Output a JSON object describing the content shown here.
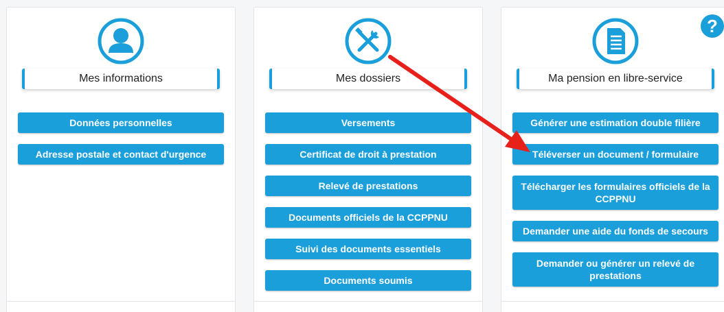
{
  "panels": {
    "info": {
      "title": "Mes informations",
      "icon": "user-icon",
      "buttons": [
        "Données personnelles",
        "Adresse postale et contact d'urgence"
      ]
    },
    "dossiers": {
      "title": "Mes dossiers",
      "icon": "tools-icon",
      "buttons": [
        "Versements",
        "Certificat de droit à prestation",
        "Relevé de prestations",
        "Documents officiels de la CCPPNU",
        "Suivi des documents essentiels",
        "Documents soumis"
      ]
    },
    "pension": {
      "title": "Ma pension en libre-service",
      "icon": "document-icon",
      "buttons": [
        "Générer une estimation double filière",
        "Téléverser un document / formulaire",
        "Télécharger les formulaires officiels de la CCPPNU",
        "Demander une aide du fonds de secours",
        "Demander ou générer un relevé de prestations"
      ]
    }
  },
  "help": {
    "icon": "help-icon",
    "glyph": "?"
  },
  "colors": {
    "accent": "#1a9fdb",
    "arrow": "#e8201a",
    "panel_border": "#e2e4e8"
  }
}
